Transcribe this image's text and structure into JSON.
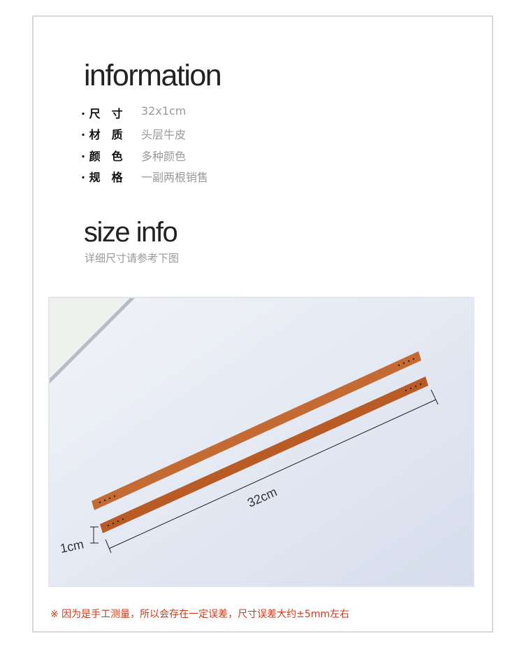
{
  "information": {
    "title": "information",
    "specs": [
      {
        "label": "· 尺　寸",
        "value": "32x1cm"
      },
      {
        "label": "· 材　质",
        "value": "头层牛皮"
      },
      {
        "label": "· 颜　色",
        "value": "多种颜色"
      },
      {
        "label": "· 规　格",
        "value": "一副两根销售"
      }
    ]
  },
  "size_info": {
    "title": "size info",
    "subtitle": "详细尺寸请参考下图",
    "photo": {
      "length_label": "32cm",
      "width_label": "1cm",
      "leather_color": "#c0662c"
    }
  },
  "note": "※ 因为是手工测量，所以会存在一定误差，尺寸误差大约±5mm左右",
  "colors": {
    "note": "#cc3a1a",
    "border": "#d9d9d9"
  }
}
